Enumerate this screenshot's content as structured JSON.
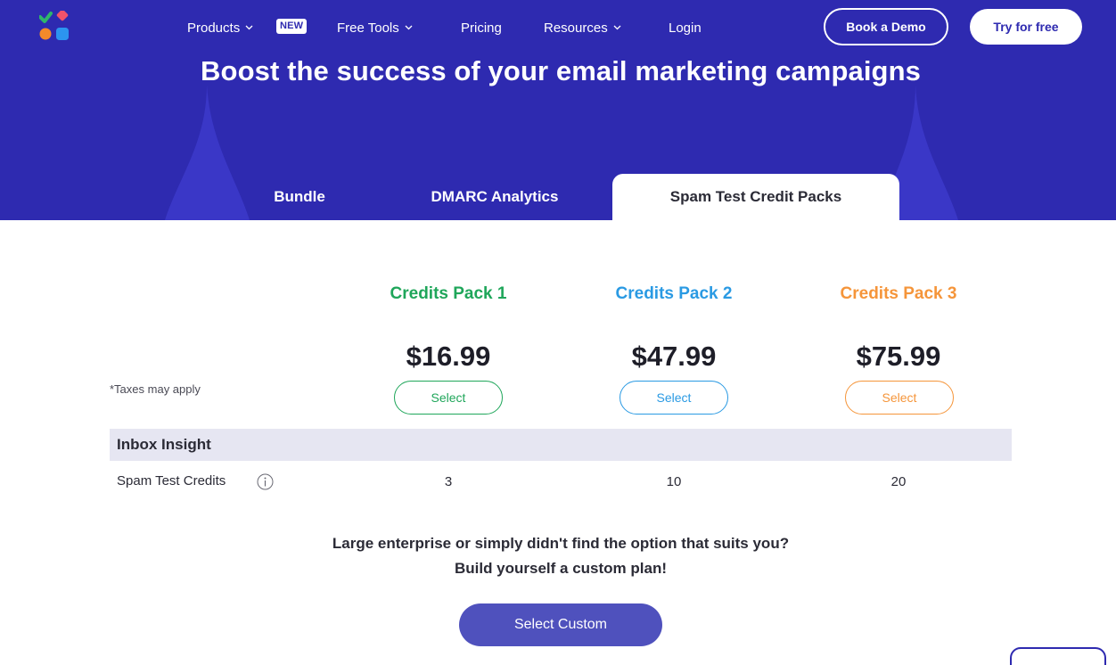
{
  "nav": {
    "items": [
      {
        "label": "Products"
      },
      {
        "label": "Free Tools"
      },
      {
        "label": "Pricing"
      },
      {
        "label": "Resources"
      },
      {
        "label": "Login"
      }
    ],
    "new_badge": "NEW",
    "book_demo": "Book a Demo",
    "try_free": "Try for free"
  },
  "hero": {
    "title": "Boost the success of your email marketing campaigns"
  },
  "tabs": [
    {
      "label": "Bundle",
      "active": false
    },
    {
      "label": "DMARC Analytics",
      "active": false
    },
    {
      "label": "Spam Test Credit Packs",
      "active": true
    }
  ],
  "pricing": {
    "taxes_note": "*Taxes may apply",
    "packs": [
      {
        "name": "Credits Pack 1",
        "price": "$16.99",
        "select_label": "Select",
        "color": "#1fa65a"
      },
      {
        "name": "Credits Pack 2",
        "price": "$47.99",
        "select_label": "Select",
        "color": "#2a9ae3"
      },
      {
        "name": "Credits Pack 3",
        "price": "$75.99",
        "select_label": "Select",
        "color": "#f5953a"
      }
    ],
    "section_title": "Inbox Insight",
    "rows": [
      {
        "label": "Spam Test Credits",
        "values": [
          "3",
          "10",
          "20"
        ]
      }
    ]
  },
  "cta": {
    "line1": "Large enterprise or simply didn't find the option that suits you?",
    "line2": "Build yourself a custom plan!",
    "button": "Select Custom"
  },
  "colors": {
    "brand": "#2e2ab0",
    "custom_button": "#4f51bd",
    "section_bg": "#e6e6f2"
  },
  "icons": [
    "logo-icon",
    "chevron-down-icon",
    "info-icon"
  ]
}
